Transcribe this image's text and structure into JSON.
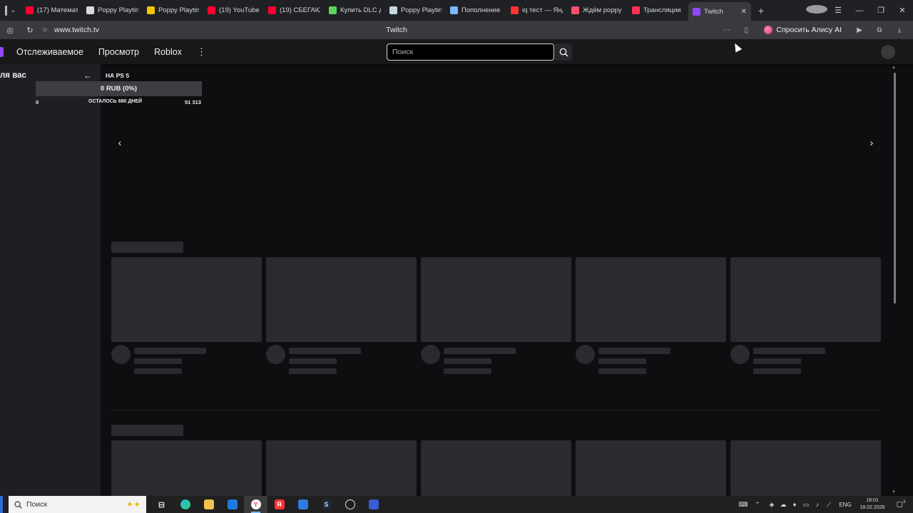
{
  "browser": {
    "tabs": [
      {
        "title": "(17) Математ",
        "icon": "youtube-icon",
        "color": "#ff0033"
      },
      {
        "title": "Poppy Playtin",
        "icon": "fandom-icon",
        "color": "#d9d9d9"
      },
      {
        "title": "Poppy Playtin",
        "icon": "yandex-play-icon",
        "color": "#f5c400"
      },
      {
        "title": "(19) YouTube",
        "icon": "youtube-icon",
        "color": "#ff0033"
      },
      {
        "title": "(19) СБЕГАЮ",
        "icon": "youtube-icon",
        "color": "#ff0033"
      },
      {
        "title": "Купить DLC д",
        "icon": "g2a-icon",
        "color": "#5cd65c"
      },
      {
        "title": "Poppy Playtin",
        "icon": "steam-icon",
        "color": "#c7d5e0"
      },
      {
        "title": "Пополнение",
        "icon": "refill-icon",
        "color": "#7ab8ff"
      },
      {
        "title": "iq тест — Янд",
        "icon": "yandex-icon",
        "color": "#ff3333"
      },
      {
        "title": "Ждём poppy",
        "icon": "pikabu-icon",
        "color": "#ff4f6d"
      },
      {
        "title": "Трансляции",
        "icon": "streams-icon",
        "color": "#ff3355"
      },
      {
        "title": "Twitch",
        "icon": "twitch-icon",
        "color": "#9147ff",
        "active": true
      }
    ],
    "url": "www.twitch.tv",
    "page_title": "Twitch",
    "alice_label": "Спросить Алису AI"
  },
  "twitch": {
    "nav": {
      "following": "Отслеживаемое",
      "browse": "Просмотр",
      "category": "Roblox",
      "more": "⋮"
    },
    "search": {
      "placeholder": "Поиск"
    },
    "sidebar": {
      "for_you": "ля вас",
      "collapse": "←"
    },
    "goal": {
      "title": "НА PS 5",
      "progress_label": "0 RUB (0%)",
      "progress_fraction": 0,
      "min": "0",
      "remaining": "ОСТАЛОСЬ 680 ДНЕЙ",
      "max": "51 313"
    },
    "carousel": {
      "prev": "‹",
      "next": "›"
    }
  },
  "taskbar": {
    "search_placeholder": "Поиск",
    "lang": "ENG",
    "time": "18:01",
    "date": "18.02.2026",
    "notifications": "3"
  },
  "colors": {
    "twitch_purple": "#9147ff",
    "page_bg": "#0e0e10",
    "skeleton": "#2b2b2f"
  }
}
